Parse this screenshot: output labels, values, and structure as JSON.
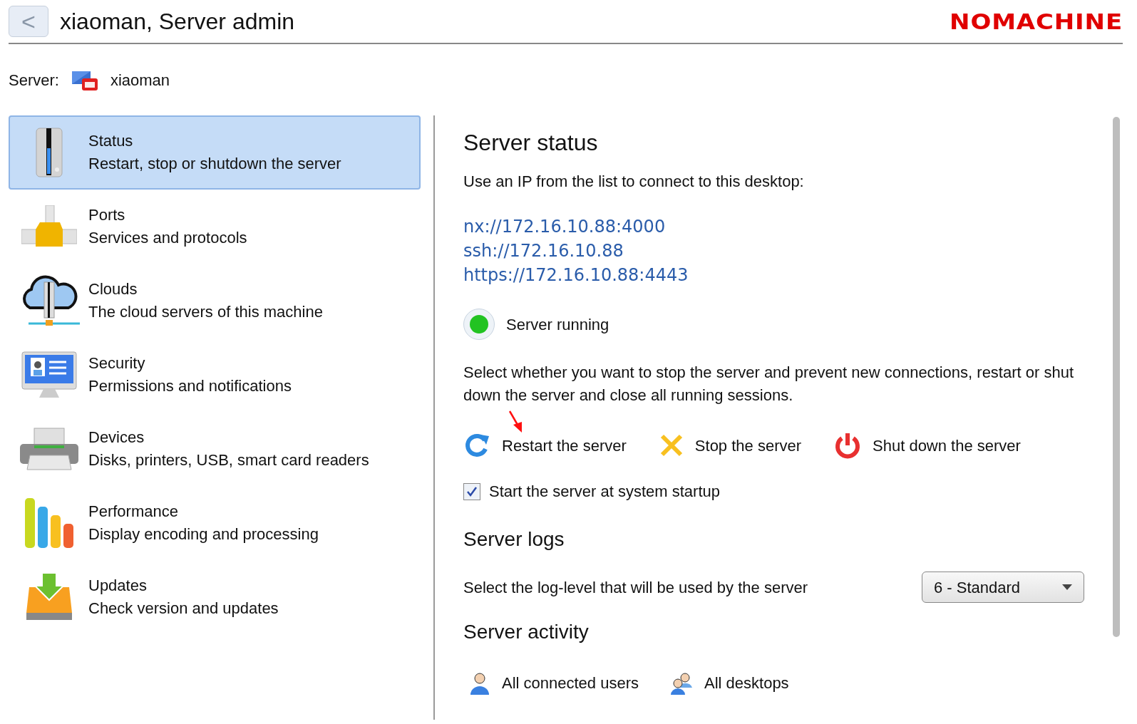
{
  "header": {
    "back_button": "<",
    "title": "xiaoman, Server admin",
    "logo": "NOMACHINE"
  },
  "server": {
    "label": "Server:",
    "name": "xiaoman"
  },
  "sidebar": {
    "items": [
      {
        "title": "Status",
        "subtitle": "Restart, stop or shutdown the server",
        "selected": true
      },
      {
        "title": "Ports",
        "subtitle": "Services and protocols",
        "selected": false
      },
      {
        "title": "Clouds",
        "subtitle": "The cloud servers of this machine",
        "selected": false
      },
      {
        "title": "Security",
        "subtitle": "Permissions and notifications",
        "selected": false
      },
      {
        "title": "Devices",
        "subtitle": "Disks, printers, USB, smart card readers",
        "selected": false
      },
      {
        "title": "Performance",
        "subtitle": "Display encoding and processing",
        "selected": false
      },
      {
        "title": "Updates",
        "subtitle": "Check version and updates",
        "selected": false
      }
    ]
  },
  "status": {
    "heading": "Server status",
    "intro": "Use an IP from the list to connect to this desktop:",
    "addresses": [
      "nx://172.16.10.88:4000",
      "ssh://172.16.10.88",
      "https://172.16.10.88:4443"
    ],
    "state": {
      "label": "Server running",
      "color": "#22c322"
    },
    "description": "Select whether you want to stop the server and prevent new connections, restart or shut down the server and close all running sessions.",
    "actions": [
      "Restart the server",
      "Stop the server",
      "Shut down the server"
    ],
    "startup": {
      "label": "Start the server at system startup",
      "checked": true
    }
  },
  "logs": {
    "heading": "Server logs",
    "label": "Select the log-level that will be used by the server",
    "level": "6 - Standard"
  },
  "activity": {
    "heading": "Server activity",
    "links": [
      "All connected users",
      "All desktops"
    ]
  }
}
